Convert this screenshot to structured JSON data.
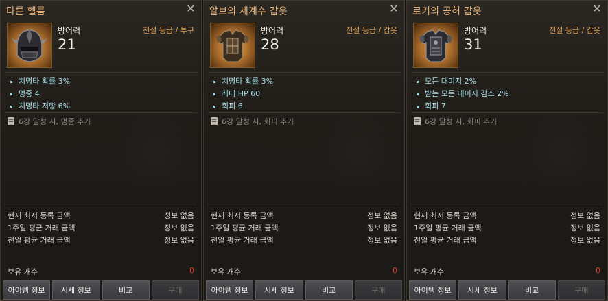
{
  "panels": [
    {
      "title": "타른 헬름",
      "item_icon": "helmet-icon",
      "stat_label": "방어력",
      "stat_value": "21",
      "grade": "전설 등급 / 투구",
      "options": [
        "치명타 확률 3%",
        "명중 4",
        "치명타 저항 6%"
      ],
      "enhance_note": "6강 달성 시, 명중 추가",
      "prices": [
        {
          "label": "현재 최저 등록 금액",
          "value": "정보 없음"
        },
        {
          "label": "1주일 평균 거래 금액",
          "value": "정보 없음"
        },
        {
          "label": "전일 평균 거래 금액",
          "value": "정보 없음"
        }
      ],
      "owned_label": "보유 개수",
      "owned_count": "0",
      "buttons": [
        "아이템 정보",
        "시세 정보",
        "비교",
        "구매"
      ]
    },
    {
      "title": "알브의 세계수 갑옷",
      "item_icon": "armor-icon",
      "stat_label": "방어력",
      "stat_value": "28",
      "grade": "전설 등급 / 갑옷",
      "options": [
        "치명타 확률 3%",
        "최대 HP 60",
        "회피 6"
      ],
      "enhance_note": "6강 달성 시, 회피 추가",
      "prices": [
        {
          "label": "현재 최저 등록 금액",
          "value": "정보 없음"
        },
        {
          "label": "1주일 평균 거래 금액",
          "value": "정보 없음"
        },
        {
          "label": "전일 평균 거래 금액",
          "value": "정보 없음"
        }
      ],
      "owned_label": "보유 개수",
      "owned_count": "0",
      "buttons": [
        "아이템 정보",
        "시세 정보",
        "비교",
        "구매"
      ]
    },
    {
      "title": "로키의 공허 갑옷",
      "item_icon": "armor-icon",
      "stat_label": "방어력",
      "stat_value": "31",
      "grade": "전설 등급 / 갑옷",
      "options": [
        "모든 대미지 2%",
        "받는 모든 대미지 감소 2%",
        "회피 7"
      ],
      "enhance_note": "6강 달성 시, 회피 추가",
      "prices": [
        {
          "label": "현재 최저 등록 금액",
          "value": "정보 없음"
        },
        {
          "label": "1주일 평균 거래 금액",
          "value": "정보 없음"
        },
        {
          "label": "전일 평균 거래 금액",
          "value": "정보 없음"
        }
      ],
      "owned_label": "보유 개수",
      "owned_count": "0",
      "buttons": [
        "아이템 정보",
        "시세 정보",
        "비교",
        "구매"
      ]
    }
  ],
  "colors": {
    "title": "#e8b070",
    "grade": "#e0a055",
    "option": "#a6dfe8",
    "owned_count": "#e0442a"
  }
}
